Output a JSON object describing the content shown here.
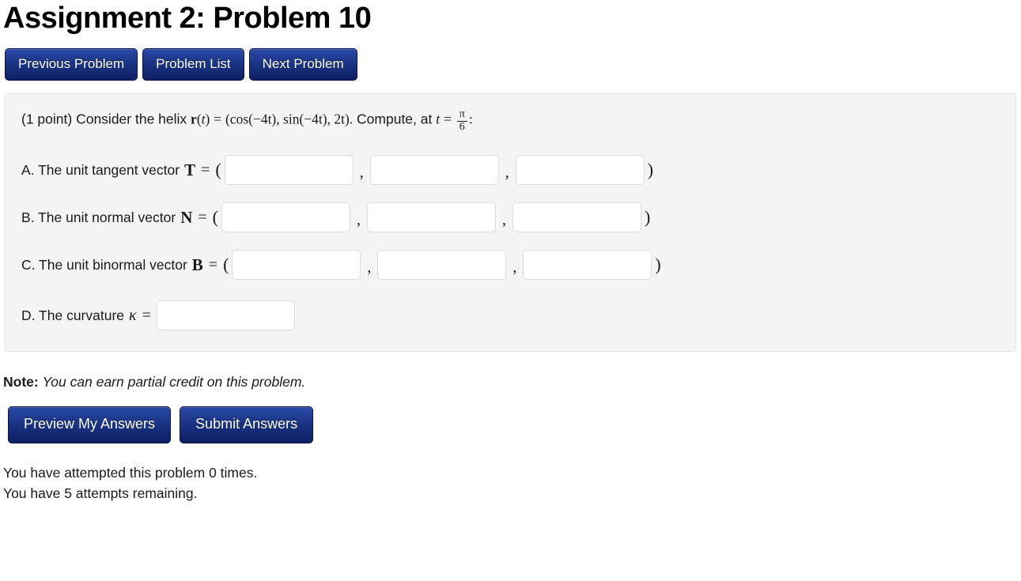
{
  "page": {
    "title": "Assignment 2: Problem 10"
  },
  "nav_buttons": [
    {
      "label": "Previous Problem",
      "name": "previous-problem-button"
    },
    {
      "label": "Problem List",
      "name": "problem-list-button"
    },
    {
      "label": "Next Problem",
      "name": "next-problem-button"
    }
  ],
  "problem": {
    "points": "(1 point)",
    "lead_text": "Consider the helix",
    "vector_symbol": "r",
    "vector_arg_open": "(",
    "vector_arg": "t",
    "vector_arg_close": ")",
    "equals": "=",
    "components_open": "(",
    "component_1": "cos(−4t)",
    "component_2": "sin(−4t)",
    "component_3": "2t",
    "components_close": ")",
    "period": ".",
    "compute_text": "Compute, at",
    "t_symbol": "t",
    "t_equals": "=",
    "t_value_numerator": "π",
    "t_value_denominator": "6",
    "colon": ":"
  },
  "answers": [
    {
      "label": "A. The unit tangent vector",
      "symbol": "T",
      "symbol_style": "bold",
      "equals": "=",
      "open_paren": "(",
      "close_paren": ")",
      "separator": ",",
      "fields": [
        {
          "name": "tangent-x-input",
          "value": "",
          "placeholder": ""
        },
        {
          "name": "tangent-y-input",
          "value": "",
          "placeholder": ""
        },
        {
          "name": "tangent-z-input",
          "value": "",
          "placeholder": ""
        }
      ]
    },
    {
      "label": "B. The unit normal vector",
      "symbol": "N",
      "symbol_style": "bold",
      "equals": "=",
      "open_paren": "(",
      "close_paren": ")",
      "separator": ",",
      "fields": [
        {
          "name": "normal-x-input",
          "value": "",
          "placeholder": ""
        },
        {
          "name": "normal-y-input",
          "value": "",
          "placeholder": ""
        },
        {
          "name": "normal-z-input",
          "value": "",
          "placeholder": ""
        }
      ]
    },
    {
      "label": "C. The unit binormal vector",
      "symbol": "B",
      "symbol_style": "bold",
      "equals": "=",
      "open_paren": "(",
      "close_paren": ")",
      "separator": ",",
      "fields": [
        {
          "name": "binormal-x-input",
          "value": "",
          "placeholder": ""
        },
        {
          "name": "binormal-y-input",
          "value": "",
          "placeholder": ""
        },
        {
          "name": "binormal-z-input",
          "value": "",
          "placeholder": ""
        }
      ]
    },
    {
      "label": "D. The curvature",
      "symbol": "κ",
      "symbol_style": "italic",
      "equals": "=",
      "open_paren": "",
      "close_paren": "",
      "separator": "",
      "fields": [
        {
          "name": "curvature-input",
          "value": "",
          "placeholder": ""
        }
      ]
    }
  ],
  "note": {
    "prefix": "Note:",
    "text": "You can earn partial credit on this problem."
  },
  "submit_buttons": [
    {
      "label": "Preview My Answers",
      "name": "preview-my-answers-button"
    },
    {
      "label": "Submit Answers",
      "name": "submit-answers-button"
    }
  ],
  "attempts": {
    "attempted": "You have attempted this problem 0 times.",
    "remaining": "You have 5 attempts remaining."
  },
  "colors": {
    "button_blue_top": "#2b4ba8",
    "button_blue_bottom": "#0e1f63",
    "panel_background": "#f4f4f4",
    "panel_border": "#e3e3e3",
    "input_border": "#dcdcdc",
    "text": "#1a1a1a"
  }
}
